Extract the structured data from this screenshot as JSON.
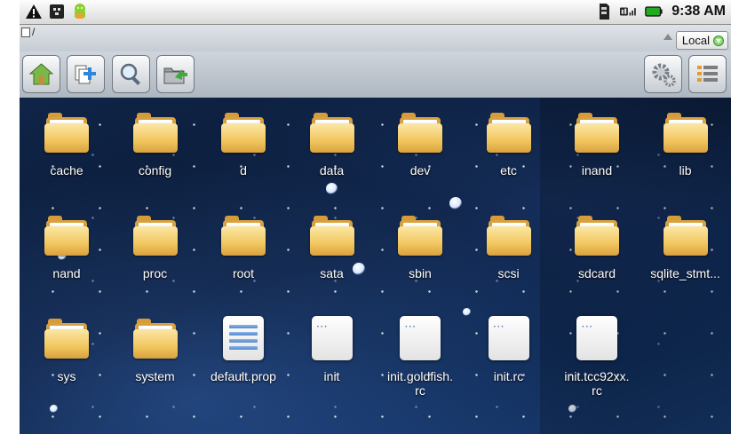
{
  "status_bar": {
    "time": "9:38 AM",
    "left_icons": [
      "warning-icon",
      "usb-debug-icon",
      "android-icon"
    ],
    "right_icons": [
      "sd-card-icon",
      "signal-icon",
      "battery-icon"
    ]
  },
  "path_bar": {
    "path": "/",
    "storage_select": "Local"
  },
  "toolbar": {
    "left_buttons": [
      "home-icon",
      "new-folder-icon",
      "search-icon",
      "move-folder-icon"
    ],
    "right_buttons": [
      "settings-icon",
      "list-view-icon"
    ]
  },
  "files": [
    {
      "name": "cache",
      "type": "folder"
    },
    {
      "name": "config",
      "type": "folder"
    },
    {
      "name": "d",
      "type": "folder"
    },
    {
      "name": "data",
      "type": "folder"
    },
    {
      "name": "dev",
      "type": "folder"
    },
    {
      "name": "etc",
      "type": "folder"
    },
    {
      "name": "inand",
      "type": "folder"
    },
    {
      "name": "lib",
      "type": "folder"
    },
    {
      "name": "nand",
      "type": "folder"
    },
    {
      "name": "proc",
      "type": "folder"
    },
    {
      "name": "root",
      "type": "folder"
    },
    {
      "name": "sata",
      "type": "folder"
    },
    {
      "name": "sbin",
      "type": "folder"
    },
    {
      "name": "scsi",
      "type": "folder"
    },
    {
      "name": "sdcard",
      "type": "folder"
    },
    {
      "name": "sqlite_stmt...",
      "type": "folder"
    },
    {
      "name": "sys",
      "type": "folder"
    },
    {
      "name": "system",
      "type": "folder"
    },
    {
      "name": "default.prop",
      "type": "text-file"
    },
    {
      "name": "init",
      "type": "file"
    },
    {
      "name": "init.goldfish.\nrc",
      "type": "file"
    },
    {
      "name": "init.rc",
      "type": "file"
    },
    {
      "name": "init.tcc92xx.\nrc",
      "type": "file"
    }
  ],
  "colors": {
    "folder": "#f1c65e",
    "background": "#0b1a34"
  }
}
